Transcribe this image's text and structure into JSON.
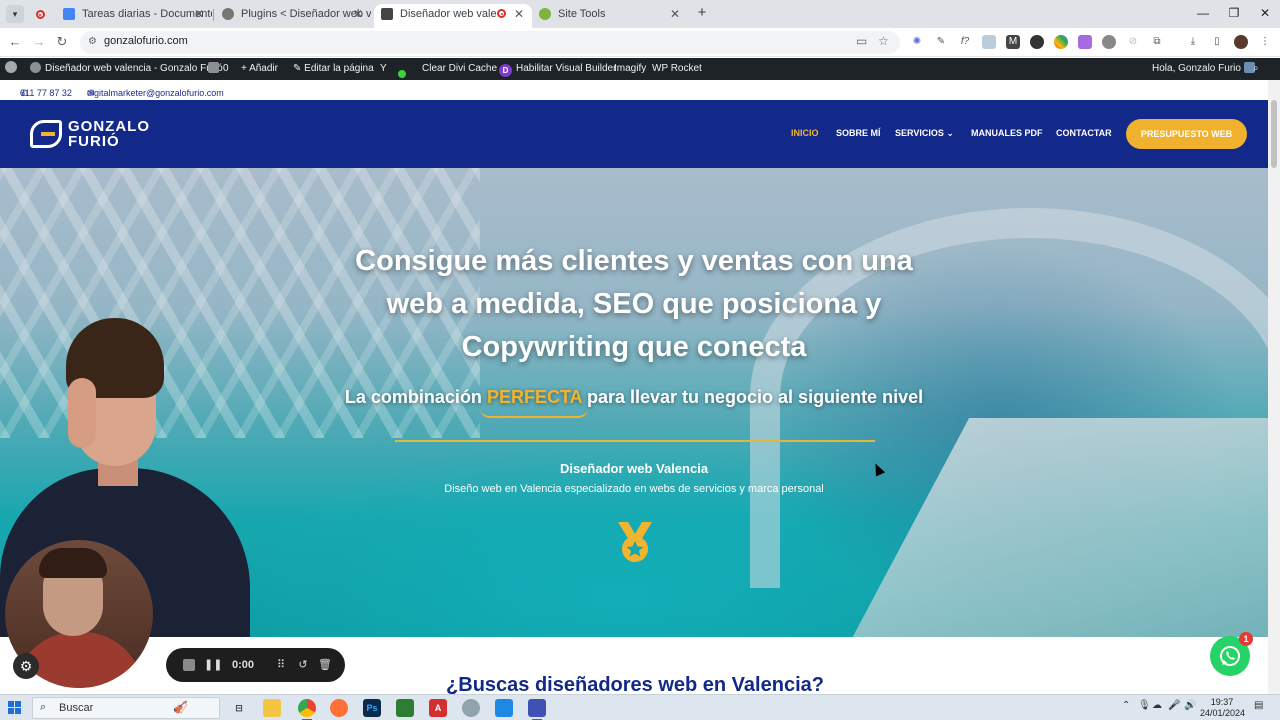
{
  "browser": {
    "tabs": [
      {
        "title": "Tareas diarias - Documentos de",
        "favicon_color": "#4285f4"
      },
      {
        "title": "Plugins < Diseñador web valen",
        "favicon_color": "#777777"
      },
      {
        "title": "Diseñador web valencia",
        "favicon_color": "#444444",
        "active": true
      },
      {
        "title": "Site Tools",
        "favicon_color": "#7cb342"
      }
    ],
    "new_tab": "+",
    "url": "gonzalofurio.com",
    "window_controls": {
      "minimize": "—",
      "restore": "❐",
      "close": "✕"
    },
    "close_glyph": "✕"
  },
  "wp_admin_bar": {
    "site_name": "Diseñador web valencia - Gonzalo Furió",
    "comments_count": "0",
    "add_new": "Añadir",
    "edit_page": "Editar la página",
    "clear_cache": "Clear Divi Cache",
    "visual_builder": "Habilitar Visual Builder",
    "imagify": "Imagify",
    "wp_rocket": "WP Rocket",
    "greeting": "Hola, Gonzalo Furio"
  },
  "topbar": {
    "phone": "611 77 87 32",
    "email": "digitalmarketer@gonzalofurio.com"
  },
  "header": {
    "logo_line1": "GONZALO",
    "logo_line2": "FURIÓ",
    "nav": [
      {
        "label": "INICIO",
        "current": true
      },
      {
        "label": "SOBRE MÍ"
      },
      {
        "label": "SERVICIOS",
        "caret": "⌄"
      },
      {
        "label": "MANUALES PDF"
      },
      {
        "label": "CONTACTAR"
      }
    ],
    "cta": "PRESUPUESTO WEB"
  },
  "hero": {
    "title_lines": [
      "Consigue más clientes y ventas con una",
      "web a medida, SEO que posiciona y",
      "Copywriting que conecta"
    ],
    "subtitle_pre": "La combinación",
    "subtitle_accent": "PERFECTA",
    "subtitle_post": "para llevar tu negocio al siguiente nivel",
    "h3": "Diseñador web Valencia",
    "paragraph": "Diseño web en Valencia especializado en webs de servicios y marca personal"
  },
  "next_section_title": "¿Buscas diseñadores web en Valencia?",
  "recorder": {
    "time": "0:00"
  },
  "whatsapp": {
    "badge": "1"
  },
  "taskbar": {
    "search_placeholder": "Buscar",
    "time": "19:37",
    "date": "24/01/2024"
  },
  "colors": {
    "brand_blue": "#13298a",
    "accent_gold": "#f1b42f",
    "wp_bar": "#1d2327",
    "whatsapp_green": "#25d366"
  }
}
